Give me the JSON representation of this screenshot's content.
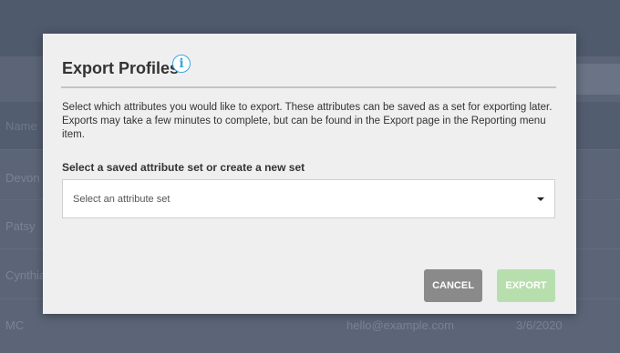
{
  "background": {
    "top_text": "",
    "header_left": "Name",
    "rows": [
      {
        "name": "Devon",
        "email": "",
        "date": ""
      },
      {
        "name": "Patsy",
        "email": "",
        "date": ""
      },
      {
        "name": "Cynthia",
        "email": "",
        "date": ""
      },
      {
        "name": "MC",
        "email": "hello@example.com",
        "date": "3/6/2020"
      }
    ]
  },
  "modal": {
    "title": "Export Profiles",
    "info_icon": "info-icon",
    "info_glyph": "i",
    "description": "Select which attributes you would like to export. These attributes can be saved as a set for exporting later. Exports may take a few minutes to complete, but can be found in the Export page in the Reporting menu item.",
    "set_label": "Select a saved attribute set or create a new set",
    "select": {
      "value": "Select an attribute set"
    },
    "buttons": {
      "cancel": "CANCEL",
      "export": "EXPORT"
    },
    "colors": {
      "cancel_bg": "#8a8a8a",
      "export_bg_disabled": "#b7dfae",
      "info_icon": "#3aa9e0"
    }
  }
}
